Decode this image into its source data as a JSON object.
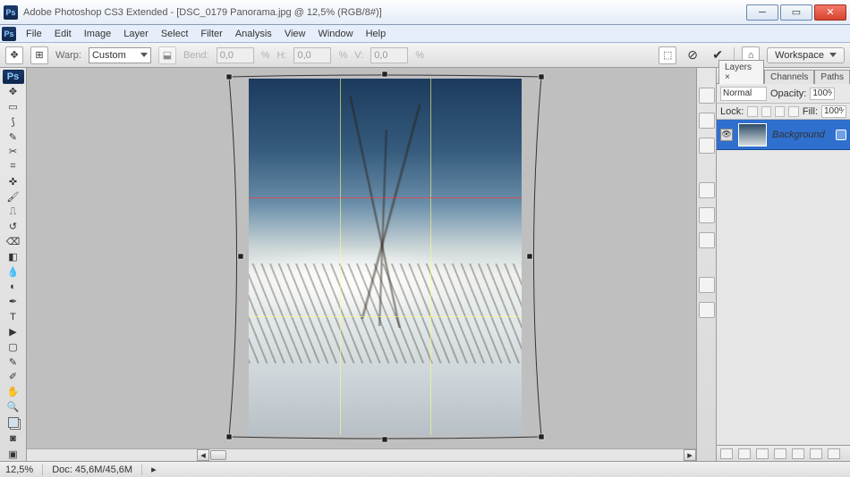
{
  "title": "Adobe Photoshop CS3 Extended - [DSC_0179 Panorama.jpg @ 12,5% (RGB/8#)]",
  "menu": [
    "File",
    "Edit",
    "Image",
    "Layer",
    "Select",
    "Filter",
    "Analysis",
    "View",
    "Window",
    "Help"
  ],
  "options": {
    "warp_label": "Warp:",
    "warp_preset": "Custom",
    "bend_label": "Bend:",
    "bend_value": "0,0",
    "h_label": "H:",
    "h_value": "0,0",
    "v_label": "V:",
    "v_value": "0,0",
    "percent": "%",
    "workspace_label": "Workspace"
  },
  "tool_ps": "Ps",
  "panels": {
    "tabs": [
      "Layers ×",
      "Channels",
      "Paths"
    ],
    "blend_mode": "Normal",
    "opacity_label": "Opacity:",
    "opacity_value": "100%",
    "lock_label": "Lock:",
    "fill_label": "Fill:",
    "fill_value": "100%",
    "layers": [
      {
        "name": "Background"
      }
    ]
  },
  "status": {
    "zoom": "12,5%",
    "doc": "Doc: 45,6M/45,6M"
  }
}
